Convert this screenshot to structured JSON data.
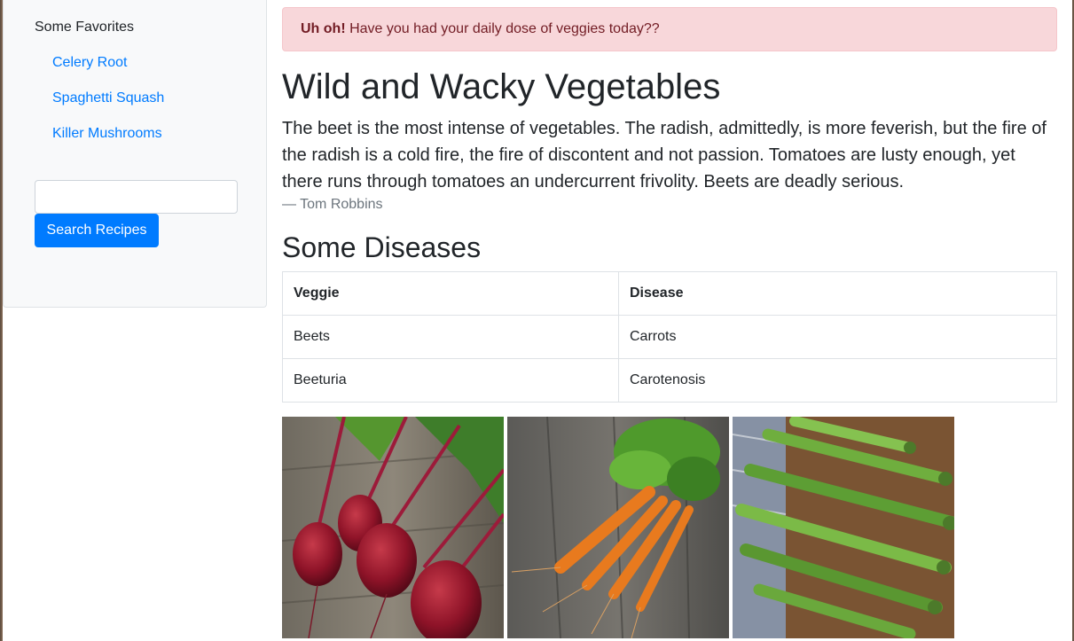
{
  "sidebar": {
    "heading": "Some Favorites",
    "favorites": [
      "Celery Root",
      "Spaghetti Squash",
      "Killer Mushrooms"
    ],
    "search": {
      "value": "",
      "placeholder": ""
    },
    "search_button": "Search Recipes"
  },
  "alert": {
    "strong": "Uh oh!",
    "message": " Have you had your daily dose of veggies today??"
  },
  "main": {
    "title": "Wild and Wacky Vegetables",
    "quote": "The beet is the most intense of vegetables. The radish, admittedly, is more feverish, but the fire of the radish is a cold fire, the fire of discontent and not passion. Tomatoes are lusty enough, yet there runs through tomatoes an undercurrent frivolity. Beets are deadly serious.",
    "quote_author": "— Tom Robbins",
    "section_title": "Some Diseases",
    "table": {
      "headers": [
        "Veggie",
        "Disease"
      ],
      "rows": [
        [
          "Beets",
          "Carrots"
        ],
        [
          "Beeturia",
          "Carotenosis"
        ]
      ]
    },
    "photos": [
      "beets-photo",
      "carrots-photo",
      "asparagus-photo"
    ]
  },
  "colors": {
    "link": "#007bff",
    "button": "#007bff",
    "alert_bg": "#f8d7da",
    "alert_text": "#721c24"
  }
}
